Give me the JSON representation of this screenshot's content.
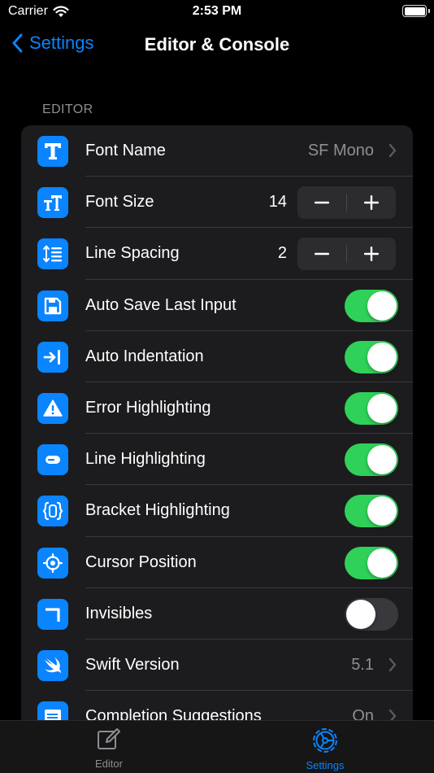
{
  "status_bar": {
    "carrier": "Carrier",
    "time": "2:53 PM"
  },
  "nav": {
    "back_label": "Settings",
    "title": "Editor & Console"
  },
  "section": {
    "header": "EDITOR"
  },
  "rows": {
    "font_name": {
      "label": "Font Name",
      "value": "SF Mono"
    },
    "font_size": {
      "label": "Font Size",
      "value": "14"
    },
    "line_spacing": {
      "label": "Line Spacing",
      "value": "2"
    },
    "auto_save": {
      "label": "Auto Save Last Input",
      "on": true
    },
    "auto_indent": {
      "label": "Auto Indentation",
      "on": true
    },
    "error_hl": {
      "label": "Error Highlighting",
      "on": true
    },
    "line_hl": {
      "label": "Line Highlighting",
      "on": true
    },
    "bracket_hl": {
      "label": "Bracket Highlighting",
      "on": true
    },
    "cursor_pos": {
      "label": "Cursor Position",
      "on": true
    },
    "invisibles": {
      "label": "Invisibles",
      "on": false
    },
    "swift_version": {
      "label": "Swift Version",
      "value": "5.1"
    },
    "completion": {
      "label": "Completion Suggestions",
      "value": "On"
    }
  },
  "stepper": {
    "minus": "−",
    "plus": "+"
  },
  "tab_bar": {
    "editor": "Editor",
    "settings": "Settings"
  },
  "colors": {
    "accent": "#0a84ff",
    "toggle_on": "#30d158",
    "toggle_off": "#39393d",
    "group_bg": "#1c1c1e"
  }
}
